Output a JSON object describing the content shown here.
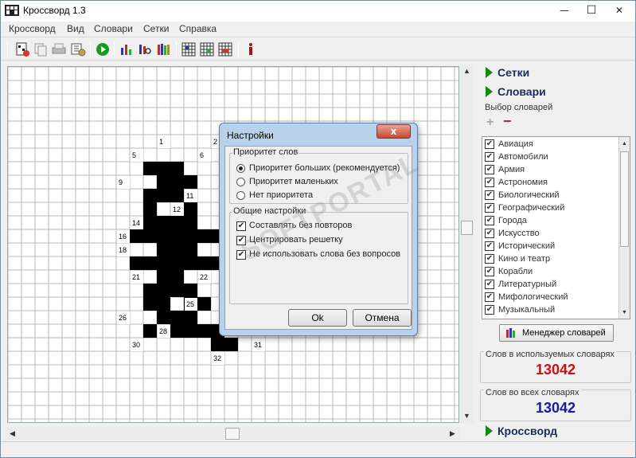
{
  "window": {
    "title": "Кроссворд 1.3",
    "controls": {
      "minimize": "—",
      "maximize": "☐",
      "close": "✕"
    }
  },
  "menu": [
    "Кроссворд",
    "Вид",
    "Словари",
    "Сетки",
    "Справка"
  ],
  "toolbar": {
    "icons": [
      "new-crossword-icon",
      "copy-icon",
      "print-icon",
      "settings-icon",
      "run-icon",
      "stats-icon",
      "search-icon",
      "books-icon",
      "grid-icon",
      "grid-edit-icon",
      "grid-numbered-icon",
      "info-icon"
    ]
  },
  "grid": {
    "numbers": [
      "1",
      "2",
      "5",
      "6",
      "9",
      "11",
      "12",
      "14",
      "16",
      "18",
      "21",
      "22",
      "25",
      "26",
      "28",
      "30",
      "31",
      "32"
    ]
  },
  "right_panel": {
    "grids_header": "Сетки",
    "dicts_header": "Словари",
    "dict_select_label": "Выбор словарей",
    "dictionaries": [
      {
        "label": "Авиация",
        "checked": "✔"
      },
      {
        "label": "Автомобили",
        "checked": "✔"
      },
      {
        "label": "Армия",
        "checked": "✔"
      },
      {
        "label": "Астрономия",
        "checked": "✔"
      },
      {
        "label": "Биологический",
        "checked": "✔"
      },
      {
        "label": "Географический",
        "checked": "✔"
      },
      {
        "label": "Города",
        "checked": "✔"
      },
      {
        "label": "Искусство",
        "checked": "✔"
      },
      {
        "label": "Исторический",
        "checked": "✔"
      },
      {
        "label": "Кино и театр",
        "checked": "✔"
      },
      {
        "label": "Корабли",
        "checked": "✔"
      },
      {
        "label": "Литературный",
        "checked": "✔"
      },
      {
        "label": "Мифологический",
        "checked": "✔"
      },
      {
        "label": "Музыкальный",
        "checked": "✔"
      }
    ],
    "dict_manager_label": "Менеджер словарей",
    "used_words_label": "Слов в используемых словарях",
    "used_words_value": "13042",
    "used_words_color": "#cc1111",
    "all_words_label": "Слов во всех словарях",
    "all_words_value": "13042",
    "all_words_color": "#1a1a99",
    "crossword_header": "Кроссворд"
  },
  "dialog": {
    "title": "Настройки",
    "close_label": "x",
    "priority_group": "Приоритет слов",
    "priority_options": [
      {
        "label": "Приоритет больших (рекомендуется)",
        "selected": true
      },
      {
        "label": "Приоритет маленьких",
        "selected": false
      },
      {
        "label": "Нет приоритета",
        "selected": false
      }
    ],
    "general_group": "Общие настройки",
    "general_options": [
      {
        "label": "Составлять без повторов",
        "checked": "✔"
      },
      {
        "label": "Центрировать решетку",
        "checked": "✔"
      },
      {
        "label": "Не использовать слова без вопросов",
        "checked": "✔"
      }
    ],
    "ok_label": "Ok",
    "cancel_label": "Отмена"
  },
  "watermark": "SOFTPORTAL"
}
